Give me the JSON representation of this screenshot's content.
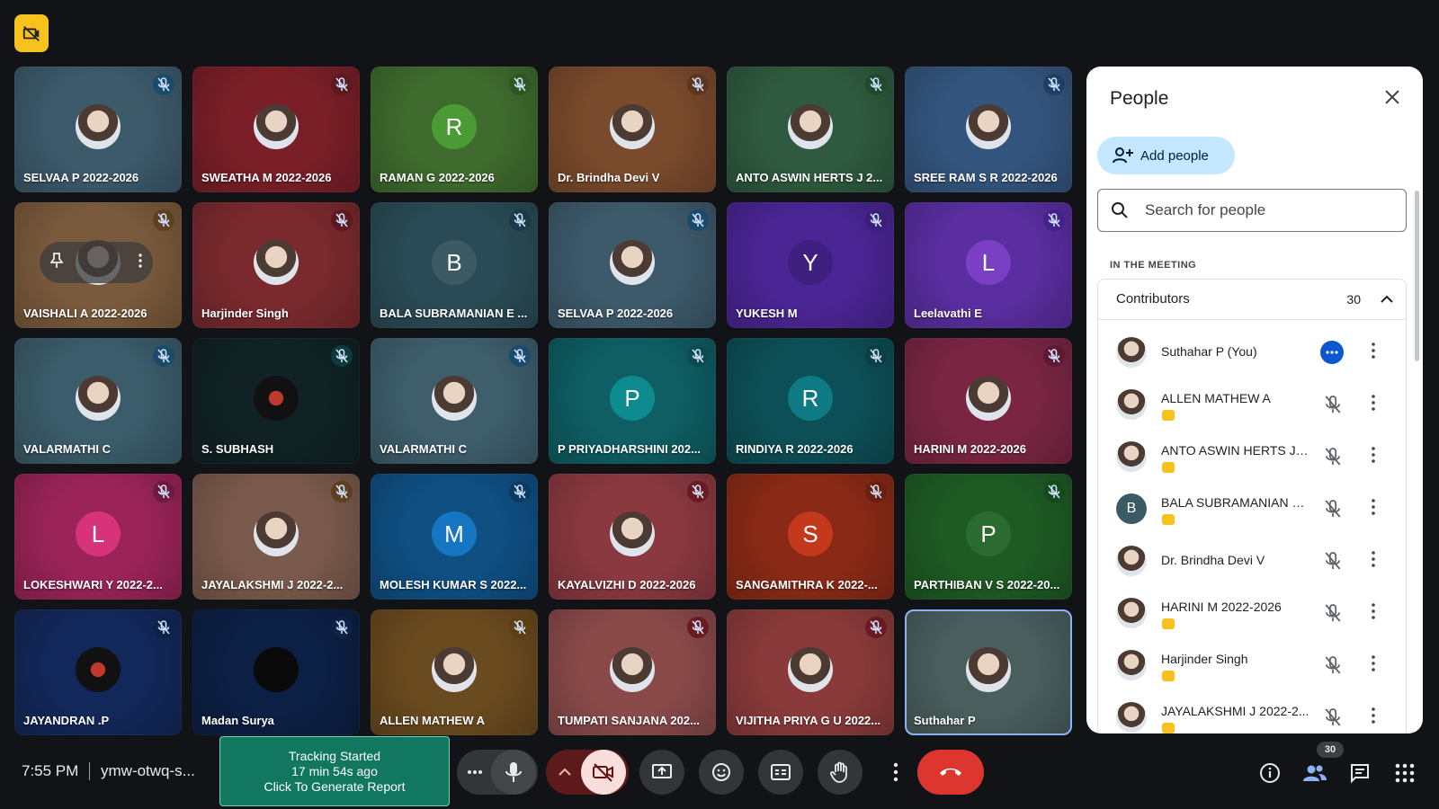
{
  "meeting": {
    "time": "7:55 PM",
    "code": "ymw-otwq-s...",
    "tracking": {
      "line1": "Tracking Started",
      "line2": "17 min 54s ago",
      "line3": "Click To Generate Report"
    },
    "participants_badge": "30"
  },
  "tiles": [
    {
      "name": "SELVAA P 2022-2026",
      "bg": "#3d5a6b",
      "avatar_type": "photo",
      "letter": "",
      "mute_bg": "#1b4b6b"
    },
    {
      "name": "SWEATHA M 2022-2026",
      "bg": "#7a1f28",
      "avatar_type": "photo",
      "letter": "",
      "mute_bg": "#5c1a20"
    },
    {
      "name": "RAMAN G 2022-2026",
      "bg": "#3f6b2e",
      "avatar_type": "letter",
      "letter": "R",
      "avatar_bg": "#4c9a36",
      "mute_bg": "#2f5522"
    },
    {
      "name": "Dr. Brindha Devi V",
      "bg": "#7a4a2c",
      "avatar_type": "photo",
      "letter": "",
      "mute_bg": "#5e3520"
    },
    {
      "name": "ANTO ASWIN HERTS J 2...",
      "bg": "#2f5a3f",
      "avatar_type": "photo",
      "letter": "",
      "mute_bg": "#1f4a2c"
    },
    {
      "name": "SREE RAM S R 2022-2026",
      "bg": "#34557e",
      "avatar_type": "photo",
      "letter": "",
      "mute_bg": "#1d3f66"
    },
    {
      "name": "VAISHALI A 2022-2026",
      "bg": "#7a5a3c",
      "avatar_type": "photo",
      "letter": "",
      "mute_bg": "#5e3f22"
    },
    {
      "name": "Harjinder Singh",
      "bg": "#7a2a2e",
      "avatar_type": "photo",
      "letter": "",
      "mute_bg": "#5c1a20"
    },
    {
      "name": "BALA SUBRAMANIAN E ...",
      "bg": "#2a4b55",
      "avatar_type": "letter",
      "letter": "B",
      "avatar_bg": "#3c5a63",
      "mute_bg": "#1b3a45"
    },
    {
      "name": "SELVAA P 2022-2026",
      "bg": "#3d5a6b",
      "avatar_type": "photo",
      "letter": "",
      "mute_bg": "#1b4b6b"
    },
    {
      "name": "YUKESH M",
      "bg": "#4a2594",
      "avatar_type": "letter",
      "letter": "Y",
      "avatar_bg": "#3f1f80",
      "mute_bg": "#3a1f78"
    },
    {
      "name": "Leelavathi E",
      "bg": "#5a2ea0",
      "avatar_type": "letter",
      "letter": "L",
      "avatar_bg": "#7b3fc4",
      "mute_bg": "#42228a"
    },
    {
      "name": "VALARMATHI C",
      "bg": "#3b5c6a",
      "avatar_type": "photo",
      "letter": "",
      "mute_bg": "#1b4b6b"
    },
    {
      "name": "S. SUBHASH",
      "bg": "#102224",
      "avatar_type": "photo_dark",
      "letter": "",
      "mute_bg": "#0e3a3a"
    },
    {
      "name": "VALARMATHI C",
      "bg": "#3e5e6c",
      "avatar_type": "photo",
      "letter": "",
      "mute_bg": "#1b4b6b"
    },
    {
      "name": "P PRIYADHARSHINI 202...",
      "bg": "#0e5e63",
      "avatar_type": "letter",
      "letter": "P",
      "avatar_bg": "#0e8b8f",
      "mute_bg": "#0b4a4f"
    },
    {
      "name": "RINDIYA R 2022-2026",
      "bg": "#0d4f56",
      "avatar_type": "letter",
      "letter": "R",
      "avatar_bg": "#0e7a83",
      "mute_bg": "#0b3f44"
    },
    {
      "name": "HARINI M 2022-2026",
      "bg": "#7a2643",
      "avatar_type": "photo",
      "letter": "",
      "mute_bg": "#5c1a30"
    },
    {
      "name": "LOKESHWARI Y 2022-2...",
      "bg": "#9a2457",
      "avatar_type": "letter",
      "letter": "L",
      "avatar_bg": "#d6337a",
      "mute_bg": "#6e1a3f"
    },
    {
      "name": "JAYALAKSHMI J 2022-2...",
      "bg": "#7a5a4c",
      "avatar_type": "photo",
      "letter": "",
      "mute_bg": "#5e3f22"
    },
    {
      "name": "MOLESH KUMAR S 2022...",
      "bg": "#0f4f82",
      "avatar_type": "letter",
      "letter": "M",
      "avatar_bg": "#1676c4",
      "mute_bg": "#0b3a62"
    },
    {
      "name": "KAYALVIZHI D 2022-2026",
      "bg": "#8a3940",
      "avatar_type": "photo",
      "letter": "",
      "mute_bg": "#6a1a20"
    },
    {
      "name": "SANGAMITHRA K 2022-...",
      "bg": "#8a2a16",
      "avatar_type": "letter",
      "letter": "S",
      "avatar_bg": "#c4381c",
      "mute_bg": "#6a1f10"
    },
    {
      "name": "PARTHIBAN V S 2022-20...",
      "bg": "#1e5a24",
      "avatar_type": "letter",
      "letter": "P",
      "avatar_bg": "#2c6b2f",
      "mute_bg": "#164a1a"
    },
    {
      "name": "JAYANDRAN .P",
      "bg": "#13285a",
      "avatar_type": "photo_dark",
      "letter": "",
      "mute_bg": "#0d2248"
    },
    {
      "name": "Madan Surya",
      "bg": "#0c1f44",
      "avatar_type": "dark",
      "letter": "",
      "mute_bg": "#0d2248"
    },
    {
      "name": "ALLEN MATHEW A",
      "bg": "#6a4a1f",
      "avatar_type": "photo",
      "letter": "",
      "mute_bg": "#5e3f12"
    },
    {
      "name": "TUMPATI SANJANA 202...",
      "bg": "#8a4a4a",
      "avatar_type": "photo",
      "letter": "",
      "mute_bg": "#6a1a20"
    },
    {
      "name": "VIJITHA PRIYA G U 2022...",
      "bg": "#8a3a3a",
      "avatar_type": "photo",
      "letter": "",
      "mute_bg": "#6a1a20"
    },
    {
      "name": "Suthahar P",
      "bg": "#4a5e5e",
      "avatar_type": "photo",
      "letter": "",
      "mute_bg": "",
      "active": true
    }
  ],
  "panel": {
    "title": "People",
    "add_people": "Add people",
    "search_placeholder": "Search for people",
    "section": "IN THE MEETING",
    "contributors_label": "Contributors",
    "contributors_count": "30",
    "people": [
      {
        "name": "Suthahar P (You)",
        "avatar_type": "photo",
        "letter": "",
        "tag": false,
        "self": true
      },
      {
        "name": "ALLEN MATHEW A",
        "avatar_type": "photo",
        "letter": "",
        "tag": true,
        "self": false
      },
      {
        "name": "ANTO ASWIN HERTS J 2...",
        "avatar_type": "photo",
        "letter": "",
        "tag": true,
        "self": false
      },
      {
        "name": "BALA SUBRAMANIAN E ...",
        "avatar_type": "letter",
        "letter": "B",
        "avatar_bg": "#3c5a63",
        "tag": true,
        "self": false
      },
      {
        "name": "Dr. Brindha Devi V",
        "avatar_type": "photo",
        "letter": "",
        "tag": false,
        "self": false
      },
      {
        "name": "HARINI M 2022-2026",
        "avatar_type": "photo",
        "letter": "",
        "tag": true,
        "self": false
      },
      {
        "name": "Harjinder Singh",
        "avatar_type": "photo",
        "letter": "",
        "tag": true,
        "self": false
      },
      {
        "name": "JAYALAKSHMI J 2022-2...",
        "avatar_type": "photo",
        "letter": "",
        "tag": true,
        "self": false
      }
    ]
  },
  "colors": {
    "accent": "#0b57d0",
    "leave": "#dc362e",
    "camera_off": "#f9dedc",
    "tracking": "#11785f"
  }
}
